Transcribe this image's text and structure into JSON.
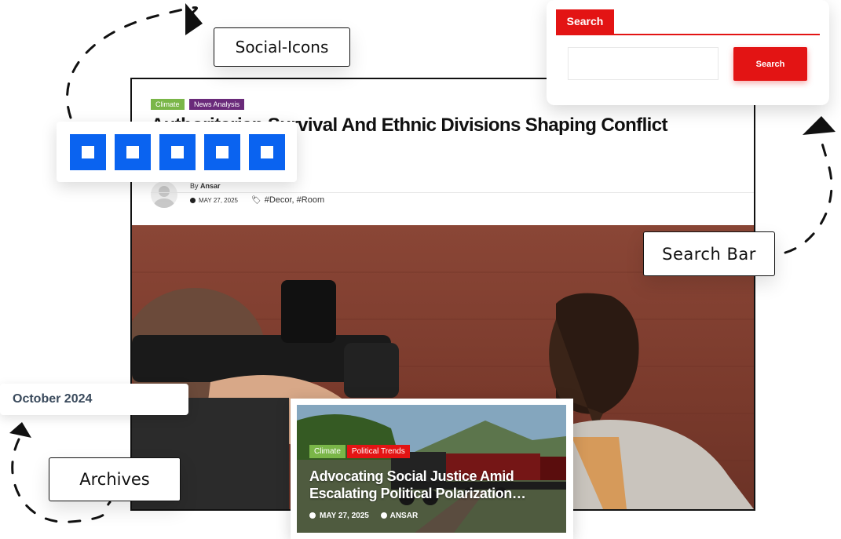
{
  "callouts": {
    "social_icons": "Social-Icons",
    "search_bar": "Search Bar",
    "archives": "Archives"
  },
  "article": {
    "categories": [
      {
        "label": "Climate",
        "color": "#7ab648"
      },
      {
        "label": "News Analysis",
        "color": "#6a2a7a"
      }
    ],
    "headline": "Authoritarian Survival And Ethnic Divisions Shaping Conflict Internationally",
    "by_prefix": "By",
    "author": "Ansar",
    "date": "MAY 27, 2025",
    "tags": "#Decor, #Room"
  },
  "social": {
    "icons": [
      "social-icon-1",
      "social-icon-2",
      "social-icon-3",
      "social-icon-4",
      "social-icon-5"
    ],
    "color": "#0a63f0"
  },
  "search_widget": {
    "title": "Search",
    "input_value": "",
    "button_label": "Search",
    "accent": "#e31414"
  },
  "archives_widget": {
    "item": "October 2024"
  },
  "post_card": {
    "categories": [
      {
        "label": "Climate",
        "color": "#7ab648"
      },
      {
        "label": "Political Trends",
        "color": "#e31414"
      }
    ],
    "title_line1": "Advocating Social Justice Amid",
    "title_line2": "Escalating Political Polarization…",
    "date": "MAY 27, 2025",
    "author": "ANSAR"
  }
}
